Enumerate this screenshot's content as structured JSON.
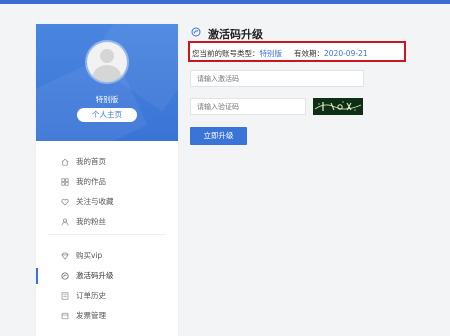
{
  "profile": {
    "tier_label": "特别版",
    "home_button": "个人主页"
  },
  "nav": {
    "group1": [
      {
        "label": "我的首页",
        "icon": "home-icon"
      },
      {
        "label": "我的作品",
        "icon": "grid-icon"
      },
      {
        "label": "关注与收藏",
        "icon": "heart-icon"
      },
      {
        "label": "我的粉丝",
        "icon": "user-icon"
      }
    ],
    "group2": [
      {
        "label": "购买vip",
        "icon": "diamond-icon"
      },
      {
        "label": "激活码升级",
        "icon": "activation-icon",
        "active": true
      },
      {
        "label": "订单历史",
        "icon": "order-icon"
      },
      {
        "label": "发票管理",
        "icon": "invoice-icon"
      }
    ]
  },
  "main": {
    "title": "激活码升级",
    "account_type_label": "您当前的账号类型：",
    "account_type_value": "特别版",
    "expiry_label": "有效期：",
    "expiry_value": "2020-09-21",
    "activation_placeholder": "请输入激活码",
    "verify_placeholder": "请输入验证码",
    "upgrade_button": "立即升级"
  },
  "colors": {
    "accent": "#3a74d6",
    "highlight_border": "#c8171e",
    "topbar": "#3c6bd8"
  }
}
